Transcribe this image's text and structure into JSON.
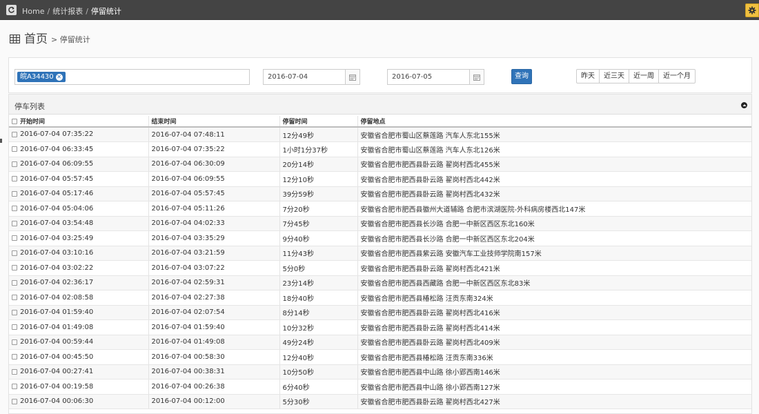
{
  "breadcrumb": {
    "home": "Home",
    "sep": "/",
    "report": "统计报表",
    "current": "停留统计"
  },
  "page": {
    "title": "首页",
    "subtitle": "> 停留统计"
  },
  "filter": {
    "plate_tag": "皖A34430",
    "start_date": "2016-07-04",
    "end_date": "2016-07-05",
    "query_label": "查询",
    "quick_ranges": [
      "昨天",
      "近三天",
      "近一周",
      "近一个月"
    ]
  },
  "list": {
    "title": "停车列表",
    "columns": [
      "开始时间",
      "结束时间",
      "停留时间",
      "停留地点"
    ],
    "rows": [
      [
        "2016-07-04 07:35:22",
        "2016-07-04 07:48:11",
        "12分49秒",
        "安徽省合肥市蜀山区蔡莲路 汽车人东北155米"
      ],
      [
        "2016-07-04 06:33:45",
        "2016-07-04 07:35:22",
        "1小时1分37秒",
        "安徽省合肥市蜀山区蔡莲路 汽车人东北126米"
      ],
      [
        "2016-07-04 06:09:55",
        "2016-07-04 06:30:09",
        "20分14秒",
        "安徽省合肥市肥西县卧云路 翟岗村西北455米"
      ],
      [
        "2016-07-04 05:57:45",
        "2016-07-04 06:09:55",
        "12分10秒",
        "安徽省合肥市肥西县卧云路 翟岗村西北442米"
      ],
      [
        "2016-07-04 05:17:46",
        "2016-07-04 05:57:45",
        "39分59秒",
        "安徽省合肥市肥西县卧云路 翟岗村西北432米"
      ],
      [
        "2016-07-04 05:04:06",
        "2016-07-04 05:11:26",
        "7分20秒",
        "安徽省合肥市肥西县徽州大道辅路 合肥市滨湖医院-外科病房楼西北147米"
      ],
      [
        "2016-07-04 03:54:48",
        "2016-07-04 04:02:33",
        "7分45秒",
        "安徽省合肥市肥西县长沙路 合肥一中新区西区东北160米"
      ],
      [
        "2016-07-04 03:25:49",
        "2016-07-04 03:35:29",
        "9分40秒",
        "安徽省合肥市肥西县长沙路 合肥一中新区西区东北204米"
      ],
      [
        "2016-07-04 03:10:16",
        "2016-07-04 03:21:59",
        "11分43秒",
        "安徽省合肥市肥西县紫云路 安徽汽车工业技师学院南157米"
      ],
      [
        "2016-07-04 03:02:22",
        "2016-07-04 03:07:22",
        "5分0秒",
        "安徽省合肥市肥西县卧云路 翟岗村西北421米"
      ],
      [
        "2016-07-04 02:36:17",
        "2016-07-04 02:59:31",
        "23分14秒",
        "安徽省合肥市肥西县西藏路 合肥一中新区西区东北83米"
      ],
      [
        "2016-07-04 02:08:58",
        "2016-07-04 02:27:38",
        "18分40秒",
        "安徽省合肥市肥西县椿松路 汪贡东南324米"
      ],
      [
        "2016-07-04 01:59:40",
        "2016-07-04 02:07:54",
        "8分14秒",
        "安徽省合肥市肥西县卧云路 翟岗村西北416米"
      ],
      [
        "2016-07-04 01:49:08",
        "2016-07-04 01:59:40",
        "10分32秒",
        "安徽省合肥市肥西县卧云路 翟岗村西北414米"
      ],
      [
        "2016-07-04 00:59:44",
        "2016-07-04 01:49:08",
        "49分24秒",
        "安徽省合肥市肥西县卧云路 翟岗村西北409米"
      ],
      [
        "2016-07-04 00:45:50",
        "2016-07-04 00:58:30",
        "12分40秒",
        "安徽省合肥市肥西县椿松路 汪贡东南336米"
      ],
      [
        "2016-07-04 00:27:41",
        "2016-07-04 00:38:31",
        "10分50秒",
        "安徽省合肥市肥西县中山路 徐小郢西南146米"
      ],
      [
        "2016-07-04 00:19:58",
        "2016-07-04 00:26:38",
        "6分40秒",
        "安徽省合肥市肥西县中山路 徐小郢西南127米"
      ],
      [
        "2016-07-04 00:06:30",
        "2016-07-04 00:12:00",
        "5分30秒",
        "安徽省合肥市肥西县卧云路 翟岗村西北427米"
      ]
    ]
  },
  "colors": {
    "topbar": "#444444",
    "primary": "#2f73b8",
    "gear": "#f0c040"
  },
  "icons": {
    "refresh": "refresh-icon",
    "settings": "gear-icon",
    "grid": "table-icon",
    "calendar": "calendar-icon",
    "remove": "remove-circle-icon",
    "collapse": "collapse-icon"
  }
}
